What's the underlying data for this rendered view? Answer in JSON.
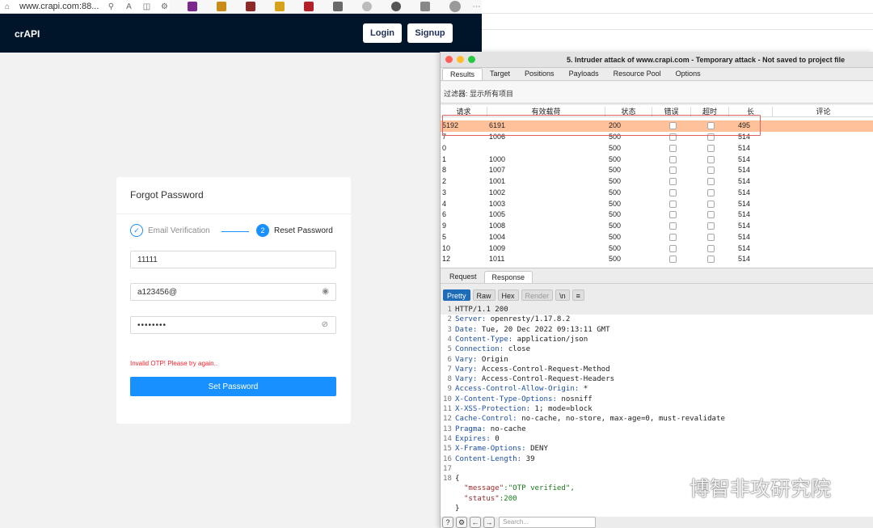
{
  "browser": {
    "url": "www.crapi.com:88...",
    "nav": {
      "brand": "crAPI",
      "login": "Login",
      "signup": "Signup"
    },
    "forgot": {
      "title": "Forgot Password",
      "step1": "Email Verification",
      "step2_number": "2",
      "step2": "Reset Password",
      "otp_value": "11111",
      "password_value": "a123456@",
      "confirm_value": "••••••••",
      "error": "Invalid OTP! Please try again..",
      "submit": "Set Password"
    }
  },
  "burp": {
    "title": "5. Intruder attack of www.crapi.com - Temporary attack - Not saved to project file",
    "tabs": [
      "Results",
      "Target",
      "Positions",
      "Payloads",
      "Resource Pool",
      "Options"
    ],
    "filter": "过滤器: 显示所有项目",
    "columns": [
      "请求",
      "有效载荷",
      "状态",
      "错误",
      "超时",
      "长",
      "评论"
    ],
    "rows": [
      [
        "5192",
        "6191",
        "200",
        "495"
      ],
      [
        "7",
        "1006",
        "500",
        "514"
      ],
      [
        "0",
        "",
        "500",
        "514"
      ],
      [
        "1",
        "1000",
        "500",
        "514"
      ],
      [
        "8",
        "1007",
        "500",
        "514"
      ],
      [
        "2",
        "1001",
        "500",
        "514"
      ],
      [
        "3",
        "1002",
        "500",
        "514"
      ],
      [
        "4",
        "1003",
        "500",
        "514"
      ],
      [
        "6",
        "1005",
        "500",
        "514"
      ],
      [
        "9",
        "1008",
        "500",
        "514"
      ],
      [
        "5",
        "1004",
        "500",
        "514"
      ],
      [
        "10",
        "1009",
        "500",
        "514"
      ],
      [
        "12",
        "1011",
        "500",
        "514"
      ]
    ],
    "reqresp_tabs": [
      "Request",
      "Response"
    ],
    "view_buttons": [
      "Pretty",
      "Raw",
      "Hex",
      "Render",
      "\\n",
      "≡"
    ],
    "response_lines": [
      {
        "n": "1",
        "k": "HTTP/1.1 200",
        "v": ""
      },
      {
        "n": "2",
        "k": "Server:",
        "v": " openresty/1.17.8.2"
      },
      {
        "n": "3",
        "k": "Date:",
        "v": " Tue, 20 Dec 2022 09:13:11 GMT"
      },
      {
        "n": "4",
        "k": "Content-Type:",
        "v": " application/json"
      },
      {
        "n": "5",
        "k": "Connection:",
        "v": " close"
      },
      {
        "n": "6",
        "k": "Vary:",
        "v": " Origin"
      },
      {
        "n": "7",
        "k": "Vary:",
        "v": " Access-Control-Request-Method"
      },
      {
        "n": "8",
        "k": "Vary:",
        "v": " Access-Control-Request-Headers"
      },
      {
        "n": "9",
        "k": "Access-Control-Allow-Origin:",
        "v": " *"
      },
      {
        "n": "10",
        "k": "X-Content-Type-Options:",
        "v": " nosniff"
      },
      {
        "n": "11",
        "k": "X-XSS-Protection:",
        "v": " 1; mode=block"
      },
      {
        "n": "12",
        "k": "Cache-Control:",
        "v": " no-cache, no-store, max-age=0, must-revalidate"
      },
      {
        "n": "13",
        "k": "Pragma:",
        "v": " no-cache"
      },
      {
        "n": "14",
        "k": "Expires:",
        "v": " 0"
      },
      {
        "n": "15",
        "k": "X-Frame-Options:",
        "v": " DENY"
      },
      {
        "n": "16",
        "k": "Content-Length:",
        "v": " 39"
      },
      {
        "n": "17",
        "k": "",
        "v": ""
      },
      {
        "n": "18",
        "k": "",
        "v": "{"
      },
      {
        "n": "",
        "k": "  \"message\"",
        "v": ":\"OTP verified\","
      },
      {
        "n": "",
        "k": "  \"status\"",
        "v": ":200"
      },
      {
        "n": "",
        "k": "",
        "v": "}"
      }
    ],
    "search_placeholder": "Search..."
  },
  "watermark": "博智非攻研究院"
}
